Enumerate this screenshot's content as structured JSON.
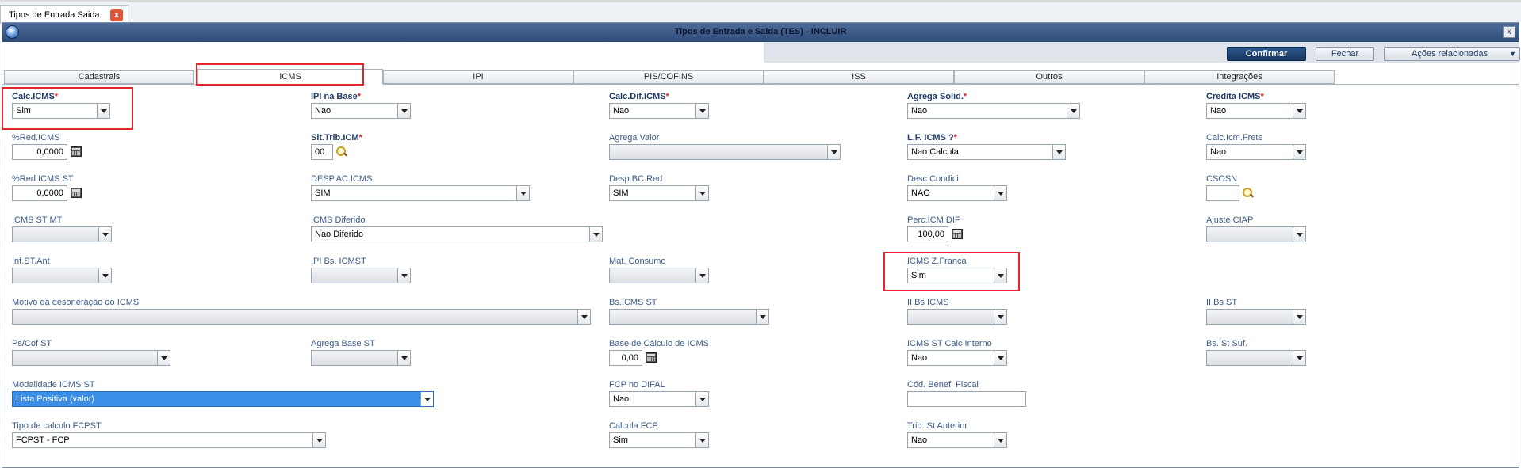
{
  "doc_tab": {
    "label": "Tipos de Entrada Saida",
    "close": "x"
  },
  "window": {
    "title": "Tipos de Entrada e Saida (TES) - INCLUIR",
    "close": "x"
  },
  "toolbar": {
    "confirm": "Confirmar",
    "close": "Fechar",
    "actions": "Ações relacionadas",
    "actions_arrow": "▼"
  },
  "tabs": [
    "Cadastrais",
    "ICMS",
    "IPI",
    "PIS/COFINS",
    "ISS",
    "Outros",
    "Integrações"
  ],
  "active_tab": "ICMS",
  "fields": {
    "calc_icms": {
      "label": "Calc.ICMS",
      "value": "Sim"
    },
    "ipi_na_base": {
      "label": "IPI na Base",
      "value": "Nao"
    },
    "calc_dif_icms": {
      "label": "Calc.Dif.ICMS",
      "value": "Nao"
    },
    "agrega_solid": {
      "label": "Agrega Solid.",
      "value": "Nao"
    },
    "credita_icms": {
      "label": "Credita ICMS",
      "value": "Nao"
    },
    "red_icms": {
      "label": "%Red.ICMS",
      "value": "0,0000"
    },
    "sit_trib_icm": {
      "label": "Sit.Trib.ICM",
      "value": "00"
    },
    "agrega_valor": {
      "label": "Agrega Valor",
      "value": ""
    },
    "lf_icms": {
      "label": "L.F. ICMS ?",
      "value": "Nao Calcula"
    },
    "calc_icm_frete": {
      "label": "Calc.Icm.Frete",
      "value": "Nao"
    },
    "red_icms_st": {
      "label": "%Red ICMS ST",
      "value": "0,0000"
    },
    "desp_ac_icms": {
      "label": "DESP.AC.ICMS",
      "value": "SIM"
    },
    "desp_bc_red": {
      "label": "Desp.BC.Red",
      "value": "SIM"
    },
    "desc_condici": {
      "label": "Desc Condici",
      "value": "NAO"
    },
    "csosn": {
      "label": "CSOSN",
      "value": ""
    },
    "icms_st_mt": {
      "label": "ICMS ST MT",
      "value": ""
    },
    "icms_diferido": {
      "label": "ICMS Diferido",
      "value": "Nao Diferido"
    },
    "perc_icm_dif": {
      "label": "Perc.ICM DIF",
      "value": "100,00"
    },
    "ajuste_ciap": {
      "label": "Ajuste CIAP",
      "value": ""
    },
    "inf_st_ant": {
      "label": "Inf.ST.Ant",
      "value": ""
    },
    "ipi_bs_icmst": {
      "label": "IPI Bs. ICMST",
      "value": ""
    },
    "mat_consumo": {
      "label": "Mat. Consumo",
      "value": ""
    },
    "icms_z_franca": {
      "label": "ICMS Z.Franca",
      "value": "Sim"
    },
    "motivo_desoneracao": {
      "label": "Motivo da desoneração do ICMS",
      "value": ""
    },
    "bs_icms_st": {
      "label": "Bs.ICMS ST",
      "value": ""
    },
    "ii_bs_icms": {
      "label": "II Bs ICMS",
      "value": ""
    },
    "ii_bs_st": {
      "label": "II Bs ST",
      "value": ""
    },
    "ps_cof_st": {
      "label": "Ps/Cof ST",
      "value": ""
    },
    "agrega_base_st": {
      "label": "Agrega Base ST",
      "value": ""
    },
    "base_calculo_icms": {
      "label": "Base de Cálculo de ICMS",
      "value": "0,00"
    },
    "icms_st_calc_interno": {
      "label": "ICMS ST Calc Interno",
      "value": "Nao"
    },
    "bs_st_suf": {
      "label": "Bs. St Suf.",
      "value": ""
    },
    "modalidade_icms_st": {
      "label": "Modalidade ICMS ST",
      "value": "Lista Positiva (valor)"
    },
    "fcp_no_difal": {
      "label": "FCP no DIFAL",
      "value": "Nao"
    },
    "cod_benef_fiscal": {
      "label": "Cód. Benef. Fiscal",
      "value": ""
    },
    "tipo_calculo_fcpst": {
      "label": "Tipo de calculo FCPST",
      "value": "FCPST -  FCP"
    },
    "calcula_fcp": {
      "label": "Calcula FCP",
      "value": "Sim"
    },
    "trib_st_anterior": {
      "label": "Trib. St Anterior",
      "value": "Nao"
    }
  },
  "required_marker": "*",
  "colors": {
    "highlight": "#e0262a",
    "primary_button": "#1f3f6e",
    "selected_field": "#3a8ee6",
    "label": "#3a5a86"
  }
}
